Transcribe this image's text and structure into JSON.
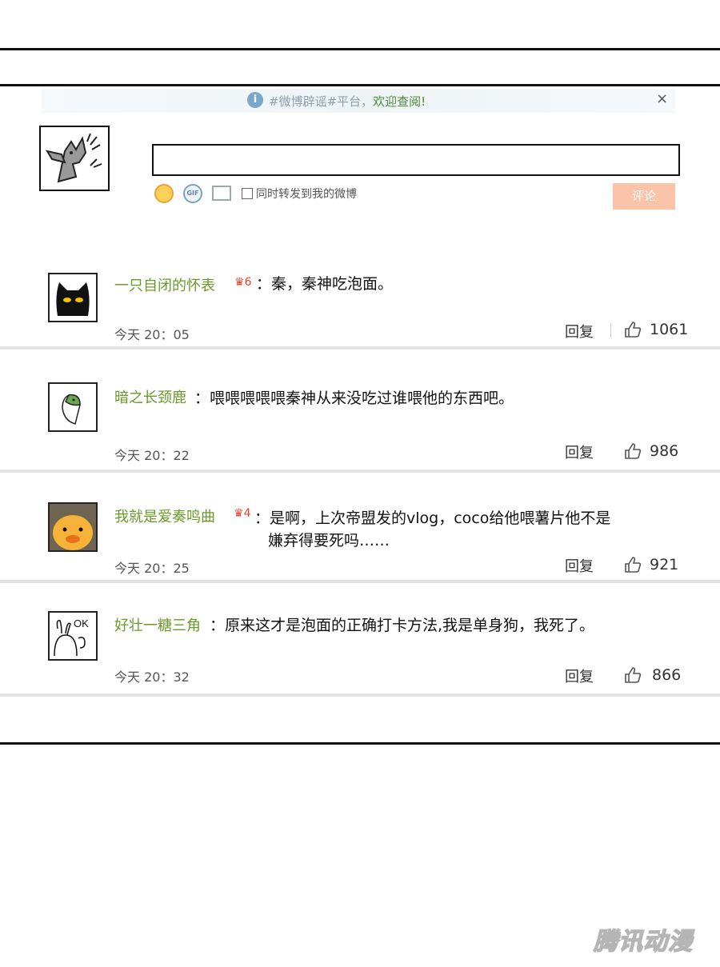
{
  "notice": {
    "info_icon": "info-icon",
    "text": "#微博辟谣#平台，",
    "link": "欢迎查阅!",
    "close": "×"
  },
  "composer": {
    "input_value": "",
    "forward_label": "同时转发到我的微博",
    "submit_label": "评论"
  },
  "comments": [
    {
      "user": "一只自闭的怀表",
      "badge": "6",
      "text_lines": [
        "：秦，秦神吃泡面。"
      ],
      "time": "今天 20：05",
      "reply": "回复",
      "likes": "1061"
    },
    {
      "user": "暗之长颈鹿",
      "badge": "",
      "text_lines": [
        "：喂喂喂喂喂秦神从来没吃过谁喂他的东西吧。"
      ],
      "time": "今天 20：22",
      "reply": "回复",
      "likes": "986"
    },
    {
      "user": "我就是爱奏鸣曲",
      "badge": "4",
      "text_lines": [
        "：是啊，上次帝盟发的vlog，coco给他喂薯片他不是",
        "嫌弃得要死吗……"
      ],
      "time": "今天 20：25",
      "reply": "回复",
      "likes": "921"
    },
    {
      "user": "好壮一糖三角",
      "badge": "",
      "text_lines": [
        "：原来这才是泡面的正确打卡方法,我是单身狗，我死了。"
      ],
      "time": "今天 20：32",
      "reply": "回复",
      "likes": "866"
    }
  ],
  "avatar4_text": "OK",
  "watermark": "腾讯动漫",
  "colors": {
    "username": "#6a9a2a",
    "submit_bg": "#fbc3a8",
    "rule": "#111111"
  }
}
